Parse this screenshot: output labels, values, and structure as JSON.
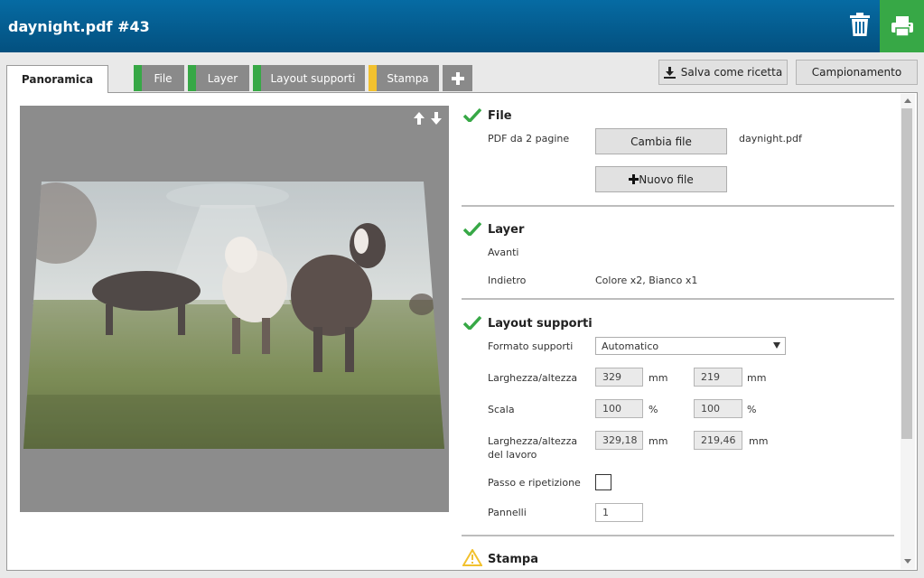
{
  "header": {
    "title": "daynight.pdf #43",
    "trash_icon": "trash-icon",
    "print_icon": "printer-icon",
    "print_bg_color": "#37a846",
    "bar_color": "#066ba3"
  },
  "tabs": [
    {
      "label": "Panoramica",
      "active": true
    },
    {
      "label": "File",
      "status_color": "#37a846"
    },
    {
      "label": "Layer",
      "status_color": "#37a846"
    },
    {
      "label": "Layout supporti",
      "status_color": "#37a846"
    },
    {
      "label": "Stampa",
      "status_color": "#f2c12e"
    }
  ],
  "add_tab_icon": "plus-icon",
  "actions": {
    "save_recipe": "Salva come ricetta",
    "save_icon": "download-icon",
    "sampling": "Campionamento"
  },
  "preview": {
    "arrows_icon": "up-down-arrows-icon"
  },
  "file_section": {
    "title": "File",
    "status_icon": "checkmark-icon",
    "description": "PDF da 2 pagine",
    "change_file": "Cambia file",
    "filename": "daynight.pdf",
    "new_file": "Nuovo file",
    "new_file_icon": "plus-icon"
  },
  "layer_section": {
    "title": "Layer",
    "status_icon": "checkmark-icon",
    "front_label": "Avanti",
    "back_label": "Indietro",
    "back_value": "Colore x2, Bianco x1"
  },
  "layout_section": {
    "title": "Layout supporti",
    "status_icon": "checkmark-icon",
    "media_format_label": "Formato supporti",
    "media_format_value": "Automatico",
    "size_label": "Larghezza/altezza",
    "width": "329",
    "height": "219",
    "size_unit": "mm",
    "scale_label": "Scala",
    "scale_x": "100",
    "scale_y": "100",
    "scale_unit": "%",
    "job_size_label_1": "Larghezza/altezza",
    "job_size_label_2": "del lavoro",
    "job_width": "329,18",
    "job_height": "219,46",
    "job_unit": "mm",
    "step_repeat_label": "Passo e ripetizione",
    "panels_label": "Pannelli",
    "panels_value": "1"
  },
  "print_section": {
    "title": "Stampa",
    "status_icon": "warning-icon",
    "warning_color": "#f2c12e"
  },
  "colors": {
    "check_green": "#37a846"
  }
}
